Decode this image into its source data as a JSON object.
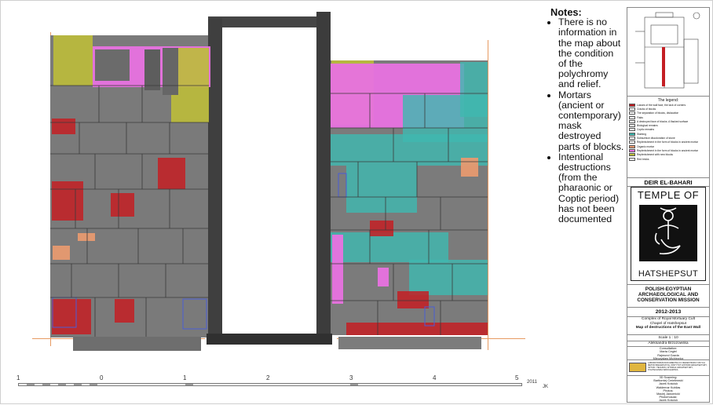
{
  "notes": {
    "title": "Notes:",
    "items": [
      "There is no information in the map about the condition of the polychromy and relief.",
      "Mortars (ancient or contemporary) mask destroyed parts of blocks.",
      "Intentional destructions (from the pharaonic or Coptic period) has not been documented"
    ]
  },
  "scale_bar": {
    "numbers": [
      "1",
      "0",
      "1",
      "2",
      "3",
      "4",
      "5"
    ],
    "year": "2011",
    "initials": "JK"
  },
  "legend": {
    "title": "The legend:",
    "items": [
      {
        "label": "Losses of the wall face, the lack of corners",
        "color": "#c41e23"
      },
      {
        "label": "Cracks of blocks",
        "color": "#ffffff"
      },
      {
        "label": "The separation of blocks, dislocation",
        "color": "#ffffff"
      },
      {
        "label": "Flaks",
        "color": "#ffffff"
      },
      {
        "label": "A destroyed face of blocks. A flacked surface",
        "color": "#ffffff"
      },
      {
        "label": "Biological remains",
        "color": "#ffffff"
      },
      {
        "label": "Coptic remains",
        "color": "#ffffff"
      },
      {
        "label": "Staining",
        "color": "#3fb8b0"
      },
      {
        "label": "Subsurface discoloration of stone",
        "color": "#ffffff"
      },
      {
        "label": "Replenishment in the form of blocks in ancient mortar",
        "color": "#ffffff"
      },
      {
        "label": "Organic mortar",
        "color": "#e79a70"
      },
      {
        "label": "Replenishment in the form of blocks in ancient mortar",
        "color": "#e872e0"
      },
      {
        "label": "Replenishment with new blocks",
        "color": "#bcbd3a"
      },
      {
        "label": "Red bricks",
        "color": "#ffffff"
      }
    ]
  },
  "site": "DEIR EL-BAHARI",
  "temple_logo": {
    "top": "TEMPLE OF",
    "bottom": "HATSHEPSUT"
  },
  "mission": [
    "POLISH-EGYPTIAN",
    "ARCHAEOLOGICAL AND",
    "CONSERVATION MISSION"
  ],
  "years": "2012-2013",
  "description": [
    "Complex of Royal Mortuary Cult",
    "Chapel of Hatshepsut"
  ],
  "map_title": "Map of destructions of the East Wall",
  "scale": "Scale 1 : 10",
  "author": "Aleksandra Brzozowska",
  "consultation": [
    "Consultation:",
    "Marta Cegiel",
    "Rajmund Gazda",
    "Mieczysław Michiewicz"
  ],
  "institution": "LABORATORIUM DOKUMENTACJI I NIEDESTRUKCYJNYCH METOD BADAWCZYCH, INSTYTUT HISTORII ARCHITEKTURY, SZTUKI I TECHNIKI, WYDZIAŁ ARCHITEKTURY, POLITECHNIKA WROCŁAWSKA",
  "credits": [
    "3D Scanning:",
    "Bartłomiej Ćmielewski",
    "Jacek Kościuk",
    "Waldemar Kubilas",
    "Photos:",
    "Maciej Jawornicki",
    "Photomosaic:",
    "Jacek Kościuk"
  ],
  "colors": {
    "loss": "#c41e23",
    "staining": "#3fb8b0",
    "mortar": "#e79a70",
    "replenish_ancient": "#e872e0",
    "replenish_new": "#bcbd3a"
  }
}
